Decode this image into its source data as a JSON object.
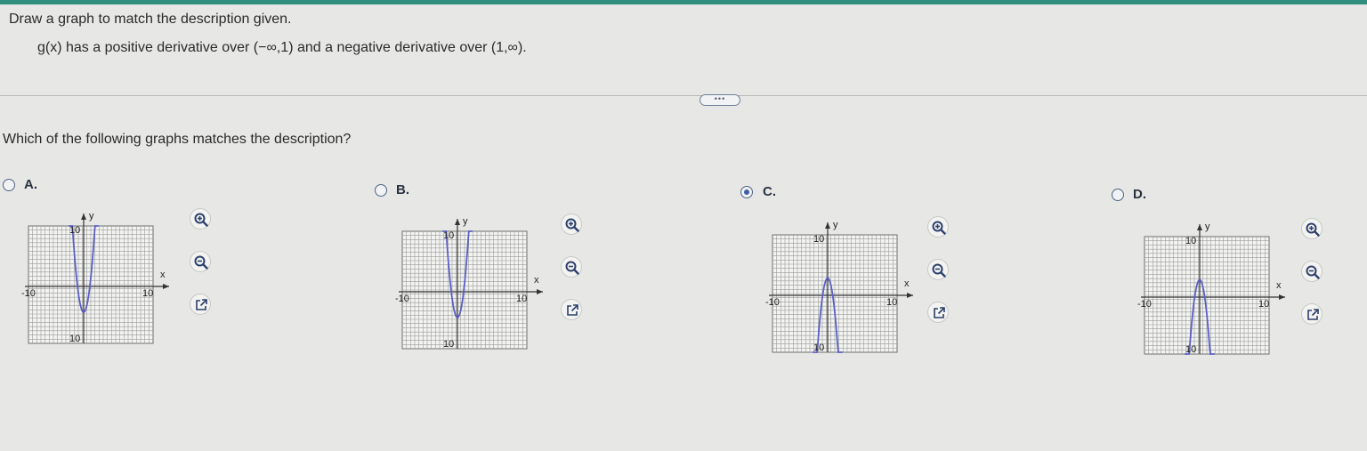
{
  "header": {
    "instruction": "Draw a graph to match the description given.",
    "statement": "g(x) has a positive derivative over (−∞,1) and a negative derivative over (1,∞).",
    "more_label": "•••"
  },
  "question": "Which of the following graphs matches the description?",
  "options": [
    {
      "letter": "A.",
      "selected": false,
      "curve": "opens-up",
      "y_label": "y",
      "x_label": "x",
      "ticks": {
        "left": "-10",
        "right": "10",
        "top": "10",
        "bottom": "10"
      }
    },
    {
      "letter": "B.",
      "selected": false,
      "curve": "opens-up",
      "y_label": "y",
      "x_label": "x",
      "ticks": {
        "left": "-10",
        "right": "10",
        "top": "10",
        "bottom": "10"
      }
    },
    {
      "letter": "C.",
      "selected": true,
      "curve": "opens-down",
      "y_label": "y",
      "x_label": "x",
      "ticks": {
        "left": "-10",
        "right": "10",
        "top": "10",
        "bottom": "10"
      }
    },
    {
      "letter": "D.",
      "selected": false,
      "curve": "opens-down",
      "y_label": "y",
      "x_label": "x",
      "ticks": {
        "left": "-10",
        "right": "10",
        "top": "10",
        "bottom": "10"
      }
    }
  ],
  "tools": [
    "zoom-in-icon",
    "zoom-out-icon",
    "open-external-icon"
  ],
  "colors": {
    "curve": "#5a5fc8",
    "grid": "#9a9c9a",
    "radio_selected": "#3c5fa8"
  }
}
